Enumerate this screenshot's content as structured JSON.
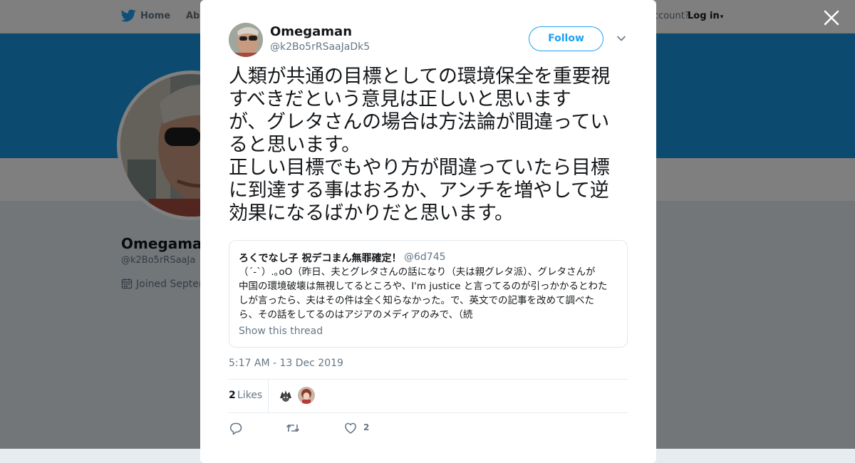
{
  "nav": {
    "home_label": "Home",
    "about_label": "Abo",
    "account_prompt": "ccount?",
    "login_label": "Log in",
    "login_caret": "▾"
  },
  "profile": {
    "name": "Omegaman",
    "handle": "@k2Bo5rRSaaJa",
    "joined": "Joined Septen"
  },
  "tweet": {
    "author_name": "Omegaman",
    "author_handle": "@k2Bo5rRSaaJaDk5",
    "follow_label": "Follow",
    "text": "人類が共通の目標としての環境保全を重要視\nすべきだという意見は正しいと思います\nが、グレタさんの場合は方法論が間違ってい\nると思います。\n正しい目標でもやり方が間違っていたら目標\nに到達する事はおろか、アンチを増やして逆\n効果になるばかりだと思います。",
    "timestamp": "5:17 AM - 13 Dec 2019",
    "likes_count": "2",
    "likes_label": "Likes",
    "like_action_count": "2"
  },
  "quoted": {
    "name": "ろくでなし子 祝デコまん無罪確定！",
    "handle": "@6d745",
    "text": "（´-`）.｡oO（昨日、夫とグレタさんの話になり（夫は親グレタ派）、グレタさんが\n中国の環境破壊は無視してるところや、I'm justice と言ってるのが引っかかるとわた\nしが言ったら、夫はその件は全く知らなかった。で、英文での記事を改めて調べた\nら、その話をしてるのはアジアのメディアのみで、（続",
    "show_thread": "Show this thread"
  },
  "colors": {
    "accent": "#1da1f2",
    "banner": "#1b95e0",
    "text": "#14171a",
    "muted": "#657786"
  },
  "icons": [
    "twitter-bird-icon",
    "close-icon",
    "chevron-down-icon",
    "calendar-icon",
    "reply-icon",
    "retweet-icon",
    "heart-icon"
  ]
}
